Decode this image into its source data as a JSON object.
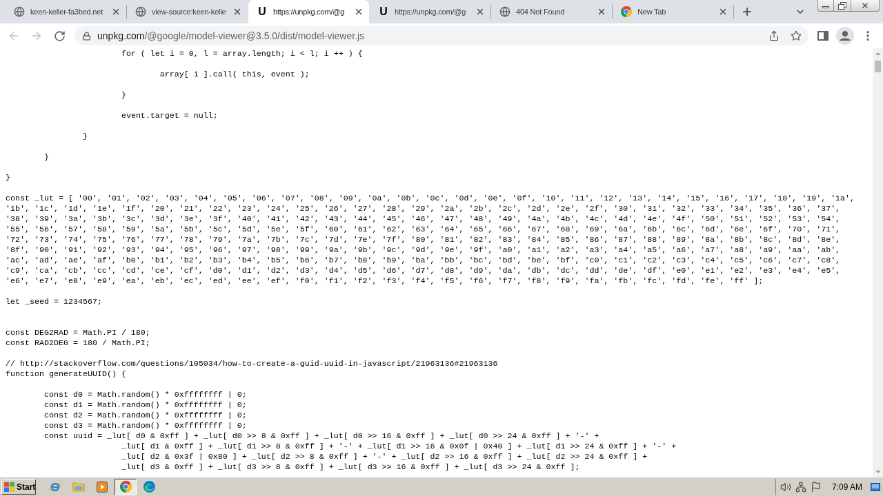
{
  "tabs": [
    {
      "title": "keen-keller-fa3bed.net",
      "favicon": {
        "kind": "globe"
      },
      "selected": false
    },
    {
      "title": "view-source:keen-kelle",
      "favicon": {
        "kind": "globe"
      },
      "selected": false
    },
    {
      "title": "https://unpkg.com/@g",
      "favicon": {
        "kind": "letter",
        "text": "U"
      },
      "selected": true
    },
    {
      "title": "https://unpkg.com/@g",
      "favicon": {
        "kind": "letter",
        "text": "U"
      },
      "selected": false
    },
    {
      "title": "404 Not Found",
      "favicon": {
        "kind": "globe"
      },
      "selected": false
    },
    {
      "title": "New Tab",
      "favicon": {
        "kind": "chrome"
      },
      "selected": false
    }
  ],
  "toolbar": {
    "back": {
      "disabled": true
    },
    "forward": {
      "disabled": true
    },
    "address": {
      "host": "unpkg.com",
      "path": "/@google/model-viewer@3.5.0/dist/model-viewer.js"
    }
  },
  "code_lines": [
    {
      "kind": "code",
      "text": "\t\t\tfor ( let i = 0, l = array.length; i < l; i ++ ) {"
    },
    {
      "kind": "blank"
    },
    {
      "kind": "code",
      "text": "\t\t\t\tarray[ i ].call( this, event );"
    },
    {
      "kind": "blank"
    },
    {
      "kind": "code",
      "text": "\t\t\t}"
    },
    {
      "kind": "blank"
    },
    {
      "kind": "code",
      "text": "\t\t\tevent.target = null;"
    },
    {
      "kind": "blank"
    },
    {
      "kind": "code",
      "text": "\t\t}"
    },
    {
      "kind": "blank"
    },
    {
      "kind": "code",
      "text": "\t}"
    },
    {
      "kind": "blank"
    },
    {
      "kind": "code",
      "text": "}"
    },
    {
      "kind": "blank"
    },
    {
      "kind": "code",
      "text": "const _lut = [ '00', '01', '02', '03', '04', '05', '06', '07', '08', '09', '0a', '0b', '0c', '0d', '0e', '0f', '10', '11', '12', '13', '14', '15', '16', '17', '18', '19', '1a', '1b', '1c', '1d', '1e', '1f', '20', '21', '22', '23', '24', '25', '26', '27', '28', '29', '2a', '2b', '2c', '2d', '2e', '2f', '30', '31', '32', '33', '34', '35', '36', '37', '38', '39', '3a', '3b', '3c', '3d', '3e', '3f', '40', '41', '42', '43', '44', '45', '46', '47', '48', '49', '4a', '4b', '4c', '4d', '4e', '4f', '50', '51', '52', '53', '54', '55', '56', '57', '58', '59', '5a', '5b', '5c', '5d', '5e', '5f', '60', '61', '62', '63', '64', '65', '66', '67', '68', '69', '6a', '6b', '6c', '6d', '6e', '6f', '70', '71', '72', '73', '74', '75', '76', '77', '78', '79', '7a', '7b', '7c', '7d', '7e', '7f', '80', '81', '82', '83', '84', '85', '86', '87', '88', '89', '8a', '8b', '8c', '8d', '8e', '8f', '90', '91', '92', '93', '94', '95', '96', '97', '98', '99', '9a', '9b', '9c', '9d', '9e', '9f', 'a0', 'a1', 'a2', 'a3', 'a4', 'a5', 'a6', 'a7', 'a8', 'a9', 'aa', 'ab', 'ac', 'ad', 'ae', 'af', 'b0', 'b1', 'b2', 'b3', 'b4', 'b5', 'b6', 'b7', 'b8', 'b9', 'ba', 'bb', 'bc', 'bd', 'be', 'bf', 'c0', 'c1', 'c2', 'c3', 'c4', 'c5', 'c6', 'c7', 'c8', 'c9', 'ca', 'cb', 'cc', 'cd', 'ce', 'cf', 'd0', 'd1', 'd2', 'd3', 'd4', 'd5', 'd6', 'd7', 'd8', 'd9', 'da', 'db', 'dc', 'dd', 'de', 'df', 'e0', 'e1', 'e2', 'e3', 'e4', 'e5', 'e6', 'e7', 'e8', 'e9', 'ea', 'eb', 'ec', 'ed', 'ee', 'ef', 'f0', 'f1', 'f2', 'f3', 'f4', 'f5', 'f6', 'f7', 'f8', 'f9', 'fa', 'fb', 'fc', 'fd', 'fe', 'ff' ];"
    },
    {
      "kind": "blank"
    },
    {
      "kind": "code",
      "text": "let _seed = 1234567;"
    },
    {
      "kind": "blank"
    },
    {
      "kind": "blank"
    },
    {
      "kind": "code",
      "text": "const DEG2RAD = Math.PI / 180;"
    },
    {
      "kind": "code",
      "text": "const RAD2DEG = 180 / Math.PI;"
    },
    {
      "kind": "blank"
    },
    {
      "kind": "code",
      "text": "// http://stackoverflow.com/questions/105034/how-to-create-a-guid-uuid-in-javascript/21963136#21963136"
    },
    {
      "kind": "code",
      "text": "function generateUUID() {"
    },
    {
      "kind": "blank"
    },
    {
      "kind": "code",
      "text": "\tconst d0 = Math.random() * 0xffffffff | 0;"
    },
    {
      "kind": "code",
      "text": "\tconst d1 = Math.random() * 0xffffffff | 0;"
    },
    {
      "kind": "code",
      "text": "\tconst d2 = Math.random() * 0xffffffff | 0;"
    },
    {
      "kind": "code",
      "text": "\tconst d3 = Math.random() * 0xffffffff | 0;"
    },
    {
      "kind": "code",
      "text": "\tconst uuid = _lut[ d0 & 0xff ] + _lut[ d0 >> 8 & 0xff ] + _lut[ d0 >> 16 & 0xff ] + _lut[ d0 >> 24 & 0xff ] + '-' +"
    },
    {
      "kind": "code",
      "text": "\t\t\t_lut[ d1 & 0xff ] + _lut[ d1 >> 8 & 0xff ] + '-' + _lut[ d1 >> 16 & 0x0f | 0x40 ] + _lut[ d1 >> 24 & 0xff ] + '-' +"
    },
    {
      "kind": "code",
      "text": "\t\t\t_lut[ d2 & 0x3f | 0x80 ] + _lut[ d2 >> 8 & 0xff ] + '-' + _lut[ d2 >> 16 & 0xff ] + _lut[ d2 >> 24 & 0xff ] +"
    },
    {
      "kind": "code",
      "text": "\t\t\t_lut[ d3 & 0xff ] + _lut[ d3 >> 8 & 0xff ] + _lut[ d3 >> 16 & 0xff ] + _lut[ d3 >> 24 & 0xff ];"
    }
  ],
  "taskbar": {
    "start": "Start",
    "apps": [
      {
        "kind": "ie",
        "selected": false
      },
      {
        "kind": "folder",
        "selected": false
      },
      {
        "kind": "media",
        "selected": false
      },
      {
        "kind": "chrome",
        "selected": true
      },
      {
        "kind": "edge",
        "selected": false
      }
    ],
    "clock": "7:09 AM"
  }
}
